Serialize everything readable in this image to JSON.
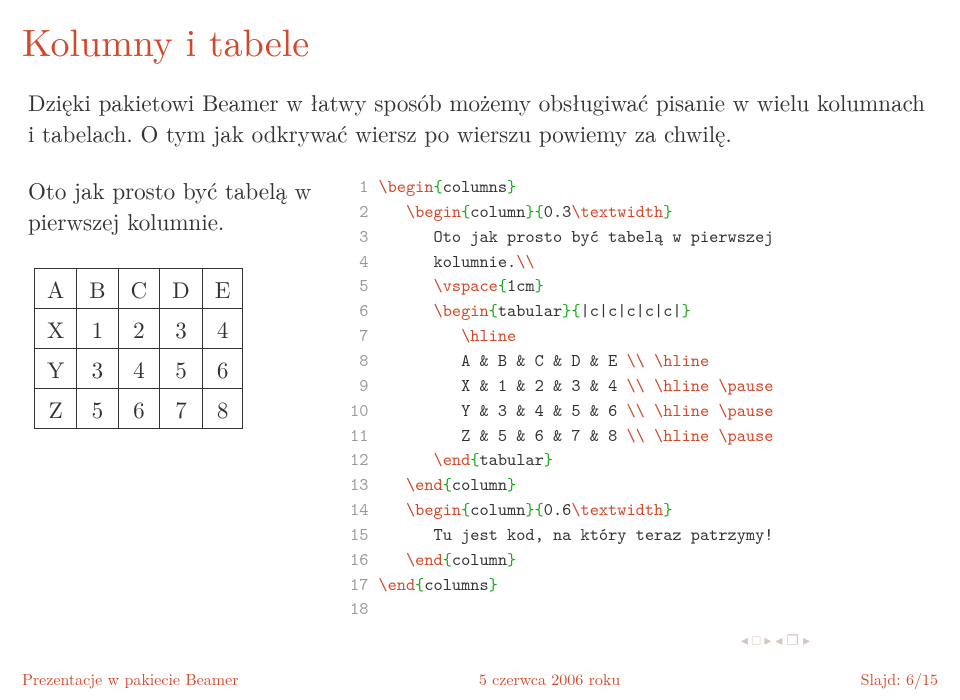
{
  "title": "Kolumny i tabele",
  "intro": "Dzięki pakietowi Beamer w łatwy sposób możemy obsługiwać pisanie w wielu kolumnach i tabelach. O tym jak odkrywać wiersz po wierszu powiemy za chwilę.",
  "left": {
    "caption": "Oto jak prosto być tabelą w pierwszej kolumnie.",
    "table": {
      "head": [
        "A",
        "B",
        "C",
        "D",
        "E"
      ],
      "rows": [
        [
          "X",
          "1",
          "2",
          "3",
          "4"
        ],
        [
          "Y",
          "3",
          "4",
          "5",
          "6"
        ],
        [
          "Z",
          "5",
          "6",
          "7",
          "8"
        ]
      ]
    }
  },
  "code": {
    "l1a": "\\begin",
    "l1b": "{",
    "l1c": "columns",
    "l1d": "}",
    "l2a": "\\begin",
    "l2b": "{",
    "l2c": "column",
    "l2d": "}{",
    "l2e": "0.3",
    "l2f": "\\textwidth",
    "l2g": "}",
    "l3": "Oto jak prosto być tabelą w pierwszej",
    "l4a": "kolumnie.",
    "l4b": "\\\\",
    "l5a": "\\vspace",
    "l5b": "{",
    "l5c": "1cm",
    "l5d": "}",
    "l6a": "\\begin",
    "l6b": "{",
    "l6c": "tabular",
    "l6d": "}{",
    "l6e": "|c|c|c|c|c|",
    "l6f": "}",
    "l7": "\\hline",
    "l8a": "A & B & C & D & E ",
    "l8b": "\\\\ \\hline",
    "l9a": "X & 1 & 2 & 3 & 4 ",
    "l9b": "\\\\ \\hline \\pause",
    "l10a": "Y & 3 & 4 & 5 & 6 ",
    "l10b": "\\\\ \\hline \\pause",
    "l11a": "Z & 5 & 6 & 7 & 8 ",
    "l11b": "\\\\ \\hline \\pause",
    "l12a": "\\end",
    "l12b": "{",
    "l12c": "tabular",
    "l12d": "}",
    "l13a": "\\end",
    "l13b": "{",
    "l13c": "column",
    "l13d": "}",
    "l14a": "\\begin",
    "l14b": "{",
    "l14c": "column",
    "l14d": "}{",
    "l14e": "0.6",
    "l14f": "\\textwidth",
    "l14g": "}",
    "l15": "Tu jest kod, na który teraz patrzymy!",
    "l16a": "\\end",
    "l16b": "{",
    "l16c": "column",
    "l16d": "}",
    "l17a": "\\end",
    "l17b": "{",
    "l17c": "columns",
    "l17d": "}",
    "lines": [
      "1",
      "2",
      "3",
      "4",
      "5",
      "6",
      "7",
      "8",
      "9",
      "10",
      "11",
      "12",
      "13",
      "14",
      "15",
      "16",
      "17",
      "18"
    ]
  },
  "footer": {
    "left": "Prezentacje w pakiecie Beamer",
    "mid": "5 czerwca 2006 roku",
    "right": "Slajd: 6/15"
  },
  "nav": {
    "a": "◂",
    "b": "□",
    "c": "▸",
    "d": "◂",
    "e": "❐",
    "f": "▸"
  }
}
